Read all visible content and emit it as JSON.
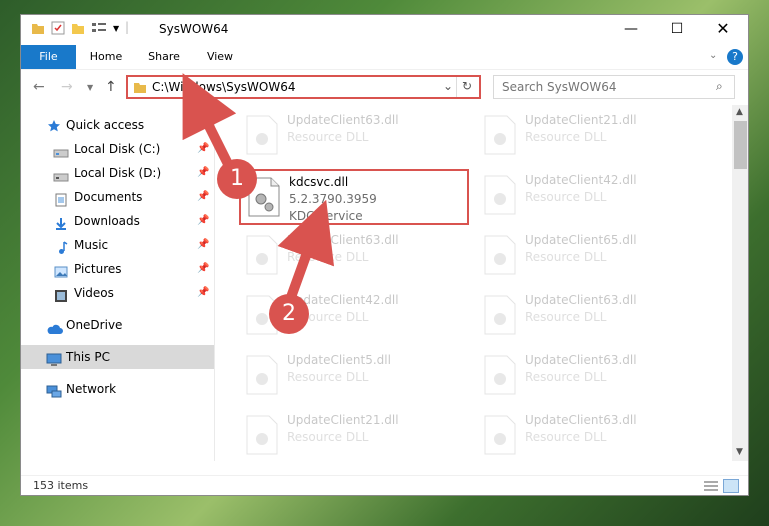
{
  "window": {
    "title": "SysWOW64",
    "controls": [
      "minimize",
      "maximize",
      "close"
    ]
  },
  "ribbon": {
    "tabs": [
      {
        "label": "File",
        "active": true
      },
      {
        "label": "Home"
      },
      {
        "label": "Share"
      },
      {
        "label": "View"
      }
    ],
    "help": "?"
  },
  "address": {
    "path": "C:\\Windows\\SysWOW64",
    "search_placeholder": "Search SysWOW64"
  },
  "nav": {
    "items": [
      {
        "label": "Quick access",
        "icon": "star-icon",
        "color": "#2b7bd6"
      },
      {
        "label": "Local Disk (C:)",
        "icon": "drive-icon",
        "pinned": true
      },
      {
        "label": "Local Disk (D:)",
        "icon": "drive-icon",
        "pinned": true
      },
      {
        "label": "Documents",
        "icon": "documents-icon",
        "pinned": true
      },
      {
        "label": "Downloads",
        "icon": "downloads-icon",
        "pinned": true
      },
      {
        "label": "Music",
        "icon": "music-icon",
        "pinned": true
      },
      {
        "label": "Pictures",
        "icon": "pictures-icon",
        "pinned": true
      },
      {
        "label": "Videos",
        "icon": "videos-icon",
        "pinned": true
      },
      {
        "label": "OneDrive",
        "icon": "cloud-icon"
      },
      {
        "label": "This PC",
        "icon": "computer-icon",
        "selected": true
      },
      {
        "label": "Network",
        "icon": "network-icon"
      }
    ]
  },
  "files": [
    {
      "name": "UpdateClient63.dll",
      "type": "Resource DLL"
    },
    {
      "name": "UpdateClient21.dll",
      "type": "Resource DLL"
    },
    {
      "name": "kdcsvc.dll",
      "version": "5.2.3790.3959",
      "type": "KDC Service",
      "highlighted": true
    },
    {
      "name": "UpdateClient42.dll",
      "type": "Resource DLL"
    },
    {
      "name": "UpdateClient63.dll",
      "type": "Resource DLL"
    },
    {
      "name": "UpdateClient65.dll",
      "type": "Resource DLL"
    },
    {
      "name": "UpdateClient42.dll",
      "type": "Resource DLL"
    },
    {
      "name": "UpdateClient63.dll",
      "type": "Resource DLL"
    },
    {
      "name": "UpdateClient5.dll",
      "type": "Resource DLL"
    },
    {
      "name": "UpdateClient63.dll",
      "type": "Resource DLL"
    },
    {
      "name": "UpdateClient21.dll",
      "type": "Resource DLL"
    },
    {
      "name": "UpdateClient63.dll",
      "type": "Resource DLL"
    }
  ],
  "status": {
    "count": "153 items"
  },
  "callouts": [
    "1",
    "2"
  ],
  "colors": {
    "accent": "#1979ca",
    "callout": "#d9534f",
    "selected_nav": "#d9d9d9"
  }
}
